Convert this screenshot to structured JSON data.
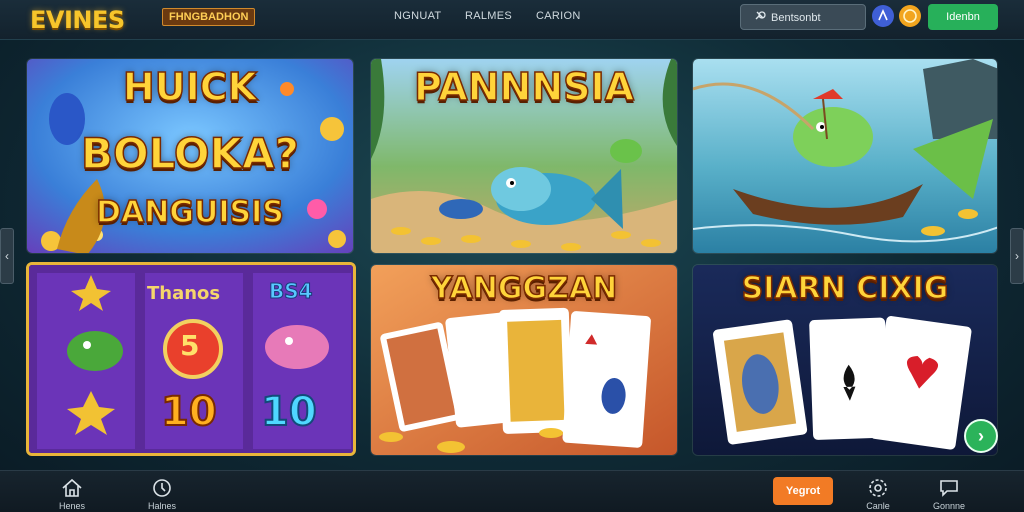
{
  "header": {
    "logo": "EVINES",
    "promo_badge": "FHNGBADHON",
    "nav": [
      "NGNUAT",
      "RALMES",
      "CARION"
    ],
    "search_placeholder": "Bentsonbt",
    "login_label": "Idenbn"
  },
  "cards": [
    {
      "title_lines": [
        "HUICK",
        "BOLOKA?",
        "DANGUISIS"
      ]
    },
    {
      "title": "PANNNSIA"
    },
    {
      "title": ""
    },
    {
      "label_left": "Thanos",
      "label_right": "BS4",
      "num_mid": "5",
      "num_left": "10",
      "num_right": "10"
    },
    {
      "title": "YANGGZAN"
    },
    {
      "title": "SIARN CIXIG"
    }
  ],
  "bottom_nav": [
    {
      "label": "Henes",
      "icon": "home-icon"
    },
    {
      "label": "Halnes",
      "icon": "clock-icon"
    },
    {
      "label": "Canle",
      "icon": "settings-icon"
    },
    {
      "label": "Gonnne",
      "icon": "chat-icon"
    }
  ],
  "report_label": "Yegrot",
  "colors": {
    "accent_gold": "#f7c52b",
    "login_green": "#27b05a",
    "report_orange": "#f27b25"
  }
}
